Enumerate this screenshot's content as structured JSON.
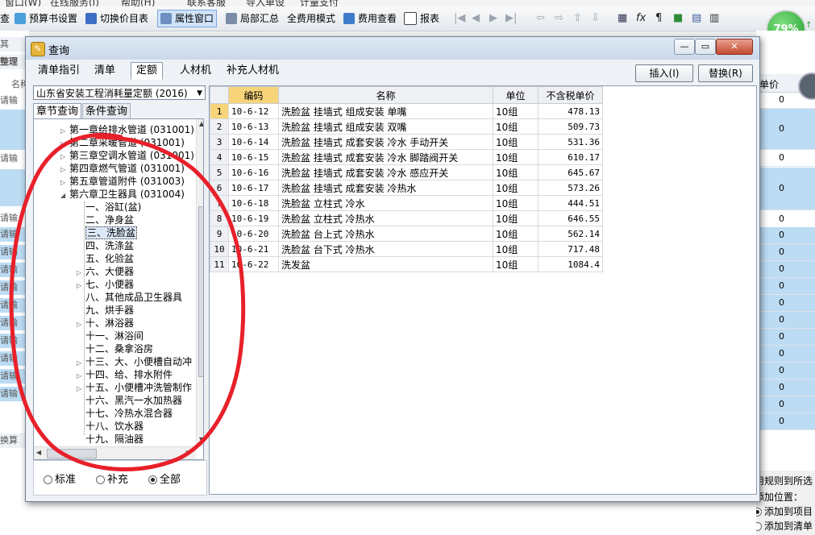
{
  "app": {
    "top_strip": [
      "窗口(W)",
      "在线服务(I)",
      "帮助(H)",
      "联系客服",
      "导入单设",
      "计量支付"
    ],
    "toolbar": [
      {
        "label": "查",
        "icon": "none"
      },
      {
        "label": "预算书设置",
        "icon": "settings-icon"
      },
      {
        "label": "切换价目表",
        "icon": "switch-icon"
      },
      {
        "label": "属性窗口",
        "icon": "window-icon",
        "active": true
      },
      {
        "label": "局部汇总",
        "icon": "sum-icon"
      },
      {
        "label": "全费用模式",
        "icon": "none"
      },
      {
        "label": "费用查看",
        "icon": "cost-icon"
      },
      {
        "label": "报表",
        "icon": "report-icon"
      }
    ],
    "progress_badge": "79%",
    "left_col": {
      "header": "名称",
      "tabs": [
        "其",
        "整理"
      ],
      "row_text": "请输",
      "bottom_label": "换算"
    },
    "right_col": {
      "header": "单价",
      "values": [
        "0",
        "0",
        "0",
        "0",
        "0",
        "0",
        "0",
        "0",
        "0",
        "0",
        "0",
        "0",
        "0",
        "0",
        "0",
        "0",
        "0"
      ]
    },
    "right_bottom": {
      "rule_label": "用规则到所选",
      "position_label": "添加位置：",
      "option1": "添加到项目",
      "option2": "添加到清单"
    }
  },
  "dialog": {
    "title": "查询",
    "tabs": [
      {
        "label": "清单指引",
        "selected": false
      },
      {
        "label": "清单",
        "selected": false
      },
      {
        "label": "定额",
        "selected": true
      },
      {
        "label": "人材机",
        "selected": false
      },
      {
        "label": "补充人材机",
        "selected": false
      }
    ],
    "insert_button": "插入(I)",
    "replace_button": "替换(R)",
    "quota_library": "山东省安装工程消耗量定额 (2016)",
    "subtabs": {
      "chapter": "章节查询",
      "condition": "条件查询"
    },
    "tree": [
      {
        "label": "第一章给排水管道 (031001)",
        "level": 0,
        "expander": "▷"
      },
      {
        "label": "第二章采暖管道 (031001)",
        "level": 0,
        "expander": "▷"
      },
      {
        "label": "第三章空调水管道 (031001)",
        "level": 0,
        "expander": "▷"
      },
      {
        "label": "第四章燃气管道 (031001)",
        "level": 0,
        "expander": "▷"
      },
      {
        "label": "第五章管道附件 (031003)",
        "level": 0,
        "expander": "▷"
      },
      {
        "label": "第六章卫生器具 (031004)",
        "level": 0,
        "expander": "◢"
      },
      {
        "label": "一、浴缸(盆)",
        "level": 1,
        "expander": ""
      },
      {
        "label": "二、净身盆",
        "level": 1,
        "expander": ""
      },
      {
        "label": "三、洗脸盆",
        "level": 1,
        "expander": "",
        "selected": true
      },
      {
        "label": "四、洗涤盆",
        "level": 1,
        "expander": ""
      },
      {
        "label": "五、化验盆",
        "level": 1,
        "expander": ""
      },
      {
        "label": "六、大便器",
        "level": 1,
        "expander": "▷"
      },
      {
        "label": "七、小便器",
        "level": 1,
        "expander": "▷"
      },
      {
        "label": "八、其他成品卫生器具",
        "level": 1,
        "expander": ""
      },
      {
        "label": "九、烘手器",
        "level": 1,
        "expander": ""
      },
      {
        "label": "十、淋浴器",
        "level": 1,
        "expander": "▷"
      },
      {
        "label": "十一、淋浴间",
        "level": 1,
        "expander": ""
      },
      {
        "label": "十二、桑拿浴房",
        "level": 1,
        "expander": ""
      },
      {
        "label": "十三、大、小便槽自动冲",
        "level": 1,
        "expander": "▷"
      },
      {
        "label": "十四、给、排水附件",
        "level": 1,
        "expander": "▷"
      },
      {
        "label": "十五、小便槽冲洗管制作",
        "level": 1,
        "expander": "▷"
      },
      {
        "label": "十六、黑汽一水加热器",
        "level": 1,
        "expander": ""
      },
      {
        "label": "十七、冷热水混合器",
        "level": 1,
        "expander": ""
      },
      {
        "label": "十八、饮水器",
        "level": 1,
        "expander": ""
      },
      {
        "label": "十九、隔油器",
        "level": 1,
        "expander": ""
      }
    ],
    "radios": [
      {
        "label": "标准",
        "checked": false
      },
      {
        "label": "补充",
        "checked": false
      },
      {
        "label": "全部",
        "checked": true
      }
    ],
    "grid": {
      "headers": [
        "",
        "编码",
        "名称",
        "单位",
        "不含税单价"
      ],
      "rows": [
        {
          "n": "1",
          "code": "10-6-12",
          "name": "洗脸盆 挂墙式 组成安装 单嘴",
          "unit": "10组",
          "price": "478.13"
        },
        {
          "n": "2",
          "code": "10-6-13",
          "name": "洗脸盆 挂墙式 组成安装 双嘴",
          "unit": "10组",
          "price": "509.73"
        },
        {
          "n": "3",
          "code": "10-6-14",
          "name": "洗脸盆 挂墙式 成套安装 冷水 手动开关",
          "unit": "10组",
          "price": "531.36"
        },
        {
          "n": "4",
          "code": "10-6-15",
          "name": "洗脸盆 挂墙式 成套安装 冷水 脚踏阀开关",
          "unit": "10组",
          "price": "610.17"
        },
        {
          "n": "5",
          "code": "10-6-16",
          "name": "洗脸盆 挂墙式 成套安装 冷水 感应开关",
          "unit": "10组",
          "price": "645.67"
        },
        {
          "n": "6",
          "code": "10-6-17",
          "name": "洗脸盆 挂墙式 成套安装 冷热水",
          "unit": "10组",
          "price": "573.26"
        },
        {
          "n": "7",
          "code": "10-6-18",
          "name": "洗脸盆 立柱式 冷水",
          "unit": "10组",
          "price": "444.51"
        },
        {
          "n": "8",
          "code": "10-6-19",
          "name": "洗脸盆 立柱式 冷热水",
          "unit": "10组",
          "price": "646.55"
        },
        {
          "n": "9",
          "code": "10-6-20",
          "name": "洗脸盆 台上式 冷热水",
          "unit": "10组",
          "price": "562.14"
        },
        {
          "n": "10",
          "code": "10-6-21",
          "name": "洗脸盆 台下式 冷热水",
          "unit": "10组",
          "price": "717.48"
        },
        {
          "n": "11",
          "code": "10-6-22",
          "name": "洗发盆",
          "unit": "10组",
          "price": "1084.4"
        }
      ]
    }
  }
}
